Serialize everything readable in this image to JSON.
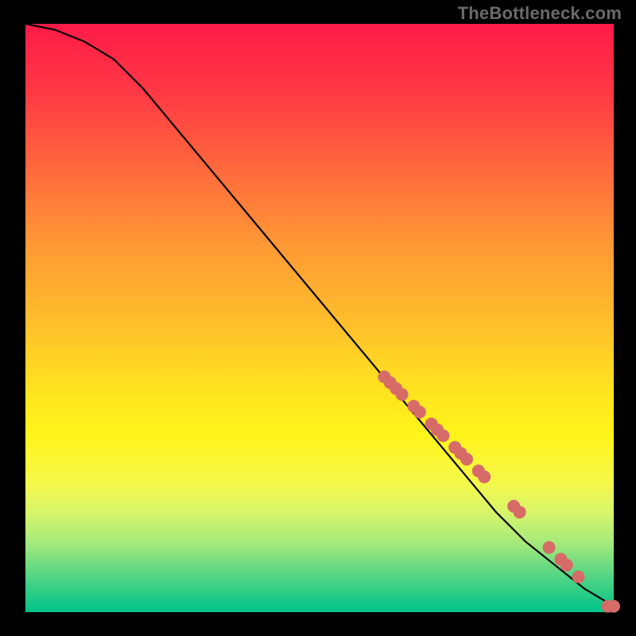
{
  "watermark": "TheBottleneck.com",
  "chart_data": {
    "type": "line",
    "title": "",
    "xlabel": "",
    "ylabel": "",
    "xlim": [
      0,
      100
    ],
    "ylim": [
      0,
      100
    ],
    "grid": false,
    "series": [
      {
        "name": "curve",
        "type": "line",
        "color": "#000000",
        "x": [
          0,
          5,
          10,
          15,
          20,
          25,
          30,
          35,
          40,
          45,
          50,
          55,
          60,
          65,
          70,
          75,
          80,
          85,
          90,
          95,
          100
        ],
        "y": [
          100,
          99,
          97,
          94,
          89,
          83,
          77,
          71,
          65,
          59,
          53,
          47,
          41,
          35,
          29,
          23,
          17,
          12,
          8,
          4,
          1
        ]
      },
      {
        "name": "cluster",
        "type": "scatter",
        "color": "#d66b68",
        "radius": 8,
        "points": [
          {
            "x": 61,
            "y": 40
          },
          {
            "x": 62,
            "y": 39
          },
          {
            "x": 63,
            "y": 38
          },
          {
            "x": 64,
            "y": 37
          },
          {
            "x": 66,
            "y": 35
          },
          {
            "x": 67,
            "y": 34
          },
          {
            "x": 69,
            "y": 32
          },
          {
            "x": 70,
            "y": 31
          },
          {
            "x": 71,
            "y": 30
          },
          {
            "x": 73,
            "y": 28
          },
          {
            "x": 74,
            "y": 27
          },
          {
            "x": 75,
            "y": 26
          },
          {
            "x": 77,
            "y": 24
          },
          {
            "x": 78,
            "y": 23
          },
          {
            "x": 83,
            "y": 18
          },
          {
            "x": 84,
            "y": 17
          },
          {
            "x": 89,
            "y": 11
          },
          {
            "x": 91,
            "y": 9
          },
          {
            "x": 92,
            "y": 8
          },
          {
            "x": 94,
            "y": 6
          },
          {
            "x": 99,
            "y": 1
          },
          {
            "x": 100,
            "y": 1
          }
        ]
      }
    ],
    "background_gradient": {
      "direction": "vertical",
      "stops": [
        {
          "pos": 0.0,
          "color": "#ff1a47"
        },
        {
          "pos": 0.5,
          "color": "#ffc22a"
        },
        {
          "pos": 0.7,
          "color": "#fff41a"
        },
        {
          "pos": 1.0,
          "color": "#00c389"
        }
      ]
    }
  }
}
